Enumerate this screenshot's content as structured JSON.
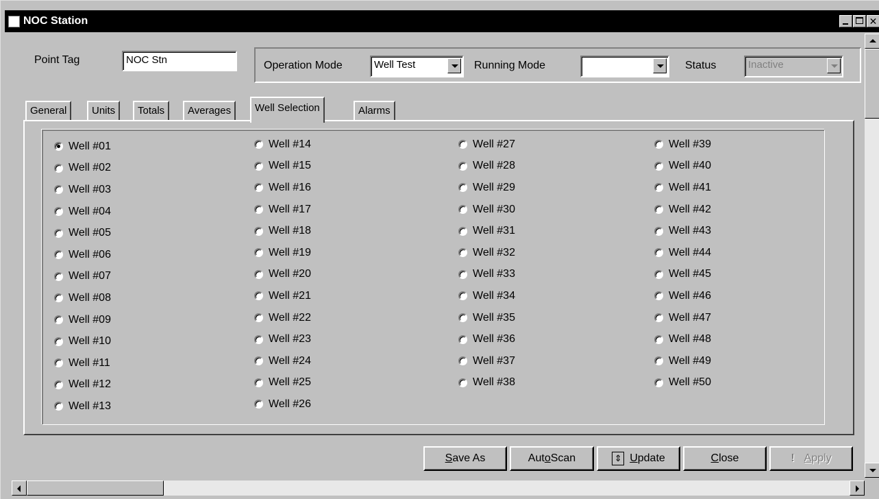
{
  "window": {
    "title": "NOC Station"
  },
  "header": {
    "point_tag_label": "Point Tag",
    "point_tag_value": "NOC Stn",
    "operation_mode_label": "Operation Mode",
    "operation_mode_value": "Well Test",
    "running_mode_label": "Running Mode",
    "running_mode_value": "",
    "status_label": "Status",
    "status_value": "Inactive"
  },
  "tabs": [
    {
      "label": "General"
    },
    {
      "label": "Units"
    },
    {
      "label": "Totals"
    },
    {
      "label": "Averages"
    },
    {
      "label": "Well Selection",
      "active": true
    },
    {
      "label": "Alarms"
    }
  ],
  "wells": {
    "selected": "Well #01",
    "columns": [
      [
        "Well #01",
        "Well #02",
        "Well #03",
        "Well #04",
        "Well #05",
        "Well #06",
        "Well #07",
        "Well #08",
        "Well #09",
        "Well #10",
        "Well #11",
        "Well #12",
        "Well #13"
      ],
      [
        "Well #14",
        "Well #15",
        "Well #16",
        "Well #17",
        "Well #18",
        "Well #19",
        "Well #20",
        "Well #21",
        "Well #22",
        "Well #23",
        "Well #24",
        "Well #25",
        "Well #26"
      ],
      [
        "Well #27",
        "Well #28",
        "Well #29",
        "Well #30",
        "Well #31",
        "Well #32",
        "Well #33",
        "Well #34",
        "Well #35",
        "Well #36",
        "Well #37",
        "Well #38"
      ],
      [
        "Well #39",
        "Well #40",
        "Well #41",
        "Well #42",
        "Well #43",
        "Well #44",
        "Well #45",
        "Well #46",
        "Well #47",
        "Well #48",
        "Well #49",
        "Well #50"
      ]
    ]
  },
  "buttons": {
    "save_as": {
      "pre": "",
      "u": "S",
      "post": "ave As"
    },
    "auto_scan": {
      "pre": "Aut",
      "u": "o",
      "post": " Scan"
    },
    "update": {
      "pre": "",
      "u": "U",
      "post": "pdate"
    },
    "close": {
      "pre": "",
      "u": "C",
      "post": "lose"
    },
    "apply": {
      "pre": "",
      "u": "A",
      "post": "pply"
    }
  }
}
